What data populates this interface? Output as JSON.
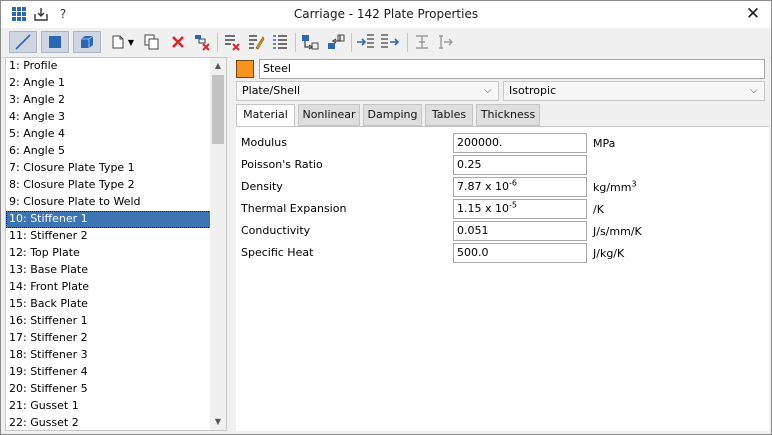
{
  "window": {
    "title": "Carriage - 142 Plate Properties",
    "help_label": "?",
    "close_label": "✕"
  },
  "colors": {
    "accent": "#3d74b3",
    "material_swatch": "#f7931e",
    "delete_red": "#d8262c"
  },
  "toolbar": {
    "icons": [
      "line-icon",
      "plate-icon",
      "brick-icon",
      "new-icon",
      "copy-icon",
      "delete-icon",
      "remove-unused-icon",
      "clear-list-icon",
      "edit-icon",
      "renumber-icon",
      "import-icon",
      "export-icon",
      "assign-icon",
      "apply-icon",
      "align-icon",
      "set-icon"
    ]
  },
  "list": {
    "items": [
      "1: Profile",
      "2: Angle 1",
      "3: Angle 2",
      "4: Angle 3",
      "5: Angle 4",
      "6: Angle 5",
      "7: Closure Plate Type 1",
      "8: Closure Plate Type 2",
      "9: Closure Plate to Weld",
      "10: Stiffener 1",
      "11: Stiffener 2",
      "12: Top Plate",
      "13: Base Plate",
      "14: Front Plate",
      "15: Back Plate",
      "16: Stiffener 1",
      "17: Stiffener 2",
      "18: Stiffener 3",
      "19: Stiffener 4",
      "20: Stiffener 5",
      "21: Gusset 1",
      "22: Gusset 2"
    ],
    "selected_index": 9
  },
  "property": {
    "name": "Steel",
    "element_type": "Plate/Shell",
    "material_model": "Isotropic"
  },
  "tabs": [
    "Material",
    "Nonlinear",
    "Damping",
    "Tables",
    "Thickness"
  ],
  "active_tab": 0,
  "material": {
    "modulus": {
      "label": "Modulus",
      "value": "200000.",
      "unit": "MPa"
    },
    "poisson": {
      "label": "Poisson's Ratio",
      "value": "0.25",
      "unit": ""
    },
    "density": {
      "label": "Density",
      "value_base": "7.87 x 10",
      "value_exp": "-6",
      "unit_base": "kg/mm",
      "unit_exp": "3"
    },
    "thermal_expansion": {
      "label": "Thermal Expansion",
      "value_base": "1.15 x 10",
      "value_exp": "-5",
      "unit": "/K"
    },
    "conductivity": {
      "label": "Conductivity",
      "value": "0.051",
      "unit": "J/s/mm/K"
    },
    "specific_heat": {
      "label": "Specific Heat",
      "value": "500.0",
      "unit": "J/kg/K"
    }
  }
}
